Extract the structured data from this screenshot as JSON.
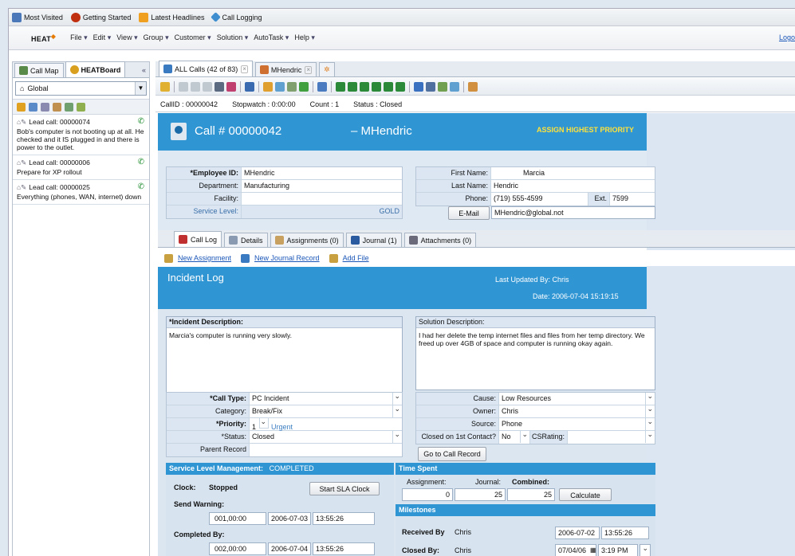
{
  "bookmarks": [
    {
      "label": "Most Visited",
      "color": "#4a78b8"
    },
    {
      "label": "Getting Started",
      "color": "#c03010"
    },
    {
      "label": "Latest Headlines",
      "color": "#f0a020"
    },
    {
      "label": "Call Logging",
      "color": "#3f8fd0"
    }
  ],
  "menu": {
    "logo": "HEAT",
    "items": [
      "File",
      "Edit",
      "View",
      "Group",
      "Customer",
      "Solution",
      "AutoTask",
      "Help"
    ],
    "logout": "Logou"
  },
  "left": {
    "tabs": [
      "Call Map",
      "HEATBoard"
    ],
    "collapse": "«",
    "group": "Global",
    "leads": [
      {
        "title": "Lead call: 00000074",
        "text": "Bob's computer is not booting up at all. He checked and it IS plugged in and there is power to the outlet."
      },
      {
        "title": "Lead call: 00000006",
        "text": "Prepare for XP rollout"
      },
      {
        "title": "Lead call: 00000025",
        "text": "Everything (phones, WAN, internet) down"
      }
    ]
  },
  "tabs": [
    {
      "label": "ALL Calls (42 of 83)"
    },
    {
      "label": "MHendric"
    }
  ],
  "info": {
    "callid": "CallID : 00000042",
    "stopwatch": "Stopwatch : 0:00:00",
    "count": "Count : 1",
    "status": "Status : Closed"
  },
  "header": {
    "call": "Call # 00000042",
    "user": "– MHendric",
    "priority": "ASSIGN HIGHEST PRIORITY"
  },
  "employee": {
    "emp_label": "*Employee ID:",
    "emp": "MHendric",
    "dept_label": "Department:",
    "dept": "Manufacturing",
    "fac_label": "Facility:",
    "fac": "",
    "svc_label": "Service Level:",
    "svc": "GOLD",
    "first_label": "First Name:",
    "first": "Marcia",
    "last_label": "Last Name:",
    "last": "Hendric",
    "phone_label": "Phone:",
    "phone": "(719) 555-4599",
    "ext_label": "Ext.",
    "ext": "7599",
    "email_label": "E-Mail",
    "email": "MHendric@global.not"
  },
  "detail_tabs": [
    "Call Log",
    "Details",
    "Assignments (0)",
    "Journal (1)",
    "Attachments (0)"
  ],
  "links": [
    "New Assignment",
    "New Journal Record",
    "Add File"
  ],
  "incident": {
    "title": "Incident Log",
    "updated": "Last Updated By:   Chris",
    "date": "Date:   2006-07-04    15:19:15",
    "desc_label": "*Incident Description:",
    "desc": "Marcia's computer is running very slowly.",
    "sol_label": "Solution Description:",
    "sol": "I had her delete the temp internet files and files from her temp directory.  We freed up over 4GB of space and computer is running okay again."
  },
  "call": {
    "type_label": "*Call Type:",
    "type": "PC Incident",
    "cat_label": "Category:",
    "cat": "Break/Fix",
    "pri_label": "*Priority:",
    "pri": "1",
    "pri_text": "Urgent",
    "status_label": "*Status:",
    "status": "Closed",
    "parent_label": "Parent Record",
    "parent": "",
    "cause_label": "Cause:",
    "cause": "Low Resources",
    "owner_label": "Owner:",
    "owner": "Chris",
    "source_label": "Source:",
    "source": "Phone",
    "closed1_label": "Closed on 1st Contact?",
    "closed1": "No",
    "csr_label": "CSRating:",
    "csr": "",
    "goto": "Go to Call Record"
  },
  "sla": {
    "title": "Service Level Management:",
    "state": "COMPLETED",
    "clock_label": "Clock:",
    "clock": "Stopped",
    "start": "Start SLA Clock",
    "warn_label": "Send Warning:",
    "warn_dur": "001,00:00",
    "warn_date": "2006-07-03",
    "warn_time": "13:55:26",
    "comp_label": "Completed By:",
    "comp_dur": "002,00:00",
    "comp_date": "2006-07-04",
    "comp_time": "13:55:26"
  },
  "time": {
    "title": "Time Spent",
    "assign_label": "Assignment:",
    "assign": "0",
    "journal_label": "Journal:",
    "journal": "25",
    "comb_label": "Combined:",
    "comb": "25",
    "calc": "Calculate"
  },
  "milestones": {
    "title": "Milestones",
    "recv_label": "Received By",
    "recv": "Chris",
    "recv_date": "2006-07-02",
    "recv_time": "13:55:26",
    "closed_label": "Closed By:",
    "closed": "Chris",
    "closed_date": "07/04/06",
    "closed_time": "3:19 PM"
  }
}
